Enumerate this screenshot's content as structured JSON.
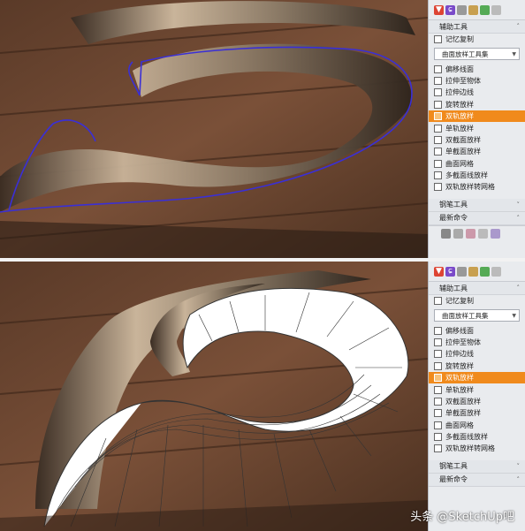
{
  "panel": {
    "section_auxiliary": "辅助工具",
    "item_memory_copy": "记忆复制",
    "dropdown_surface_loft": "曲面放样工具集",
    "items": [
      "偏移线面",
      "拉伸至物体",
      "拉伸边线",
      "旋转放样",
      "双轨放样",
      "单轨放样",
      "双截面放样",
      "单截面放样",
      "曲面网格",
      "多截面线放样",
      "双轨放样转网格"
    ],
    "active_index": 4,
    "section_brush": "钢笔工具",
    "section_recent": "最新命令"
  },
  "watermark": "头条 @SketchUp吧",
  "colors": {
    "active_item": "#f08a1c",
    "outline": "#3a2fd6",
    "panel_bg": "#e9ebee"
  }
}
